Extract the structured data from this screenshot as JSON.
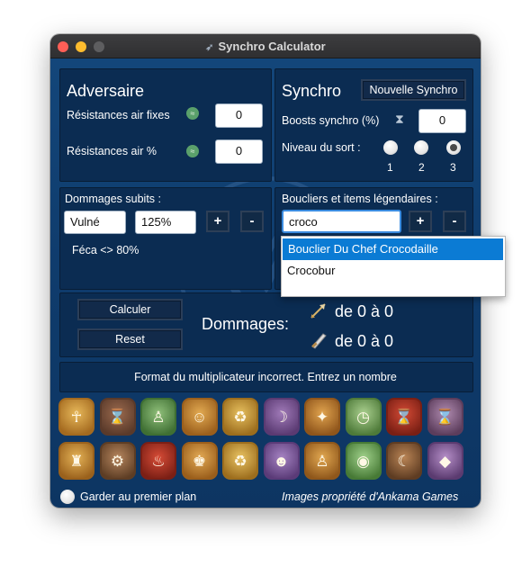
{
  "window": {
    "title": "Synchro Calculator"
  },
  "adversaire": {
    "heading": "Adversaire",
    "fixed_label": "Résistances air fixes",
    "fixed_value": "0",
    "pct_label": "Résistances air %",
    "pct_value": "0"
  },
  "synchro": {
    "heading": "Synchro",
    "new_button": "Nouvelle Synchro",
    "boosts_label": "Boosts synchro (%)",
    "boosts_value": "0",
    "level_label": "Niveau du sort :",
    "levels": [
      "1",
      "2",
      "3"
    ],
    "selected_level": "3"
  },
  "damages_taken": {
    "label": "Dommages subits :",
    "type_value": "Vulné",
    "pct_value": "125%",
    "plus": "+",
    "minus": "-",
    "entry": "Féca <> 80%"
  },
  "shields": {
    "label": "Boucliers et items légendaires :",
    "search_value": "croco",
    "plus": "+",
    "minus": "-",
    "suggestions": [
      "Bouclier Du Chef Crocodaille",
      "Crocobur"
    ]
  },
  "actions": {
    "calculate": "Calculer",
    "reset": "Reset",
    "damages_label": "Dommages:",
    "ranged_result": "de 0 à 0",
    "melee_result": "de 0 à 0"
  },
  "status_message": "Format du multiplicateur incorrect. Entrez un nombre",
  "icon_rows": [
    [
      "sword-tile-icon",
      "hourglass-tile-icon",
      "person-tile-icon",
      "figure-tile-icon",
      "recycle-tile-icon",
      "dash-tile-icon",
      "wing-tile-icon",
      "clock-tile-icon",
      "hourglass-red-tile-icon",
      "hourglass-purple-tile-icon"
    ],
    [
      "statue-tile-icon",
      "gear-tile-icon",
      "glyph-red-tile-icon",
      "figure-pair-tile-icon",
      "recycle-tile-icon-2",
      "mask-tile-icon",
      "figure-tile-icon-2",
      "orb-tile-icon",
      "moon-tile-icon",
      "crystal-tile-icon"
    ]
  ],
  "footer": {
    "keep_on_top": "Garder au premier plan",
    "credits": "Images propriété d'Ankama Games"
  },
  "colors": {
    "background": "#0f3c6d",
    "panel": "#0b2c52",
    "highlight": "#0b7bd4"
  }
}
